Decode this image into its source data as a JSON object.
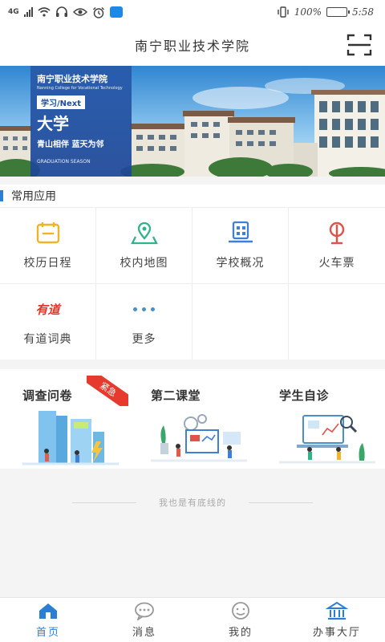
{
  "status_bar": {
    "network": "4G",
    "battery_text": "100%",
    "battery_level": 1.0,
    "time": "5:58",
    "icons": [
      "signal-icon",
      "wifi-icon",
      "headset-icon",
      "eye-icon",
      "alarm-icon",
      "app-notification-icon",
      "vibrate-icon",
      "battery-icon"
    ]
  },
  "header": {
    "title": "南宁职业技术学院",
    "scan_icon": "scan-icon"
  },
  "banner": {
    "school_name": "南宁职业技术学院",
    "school_name_en": "Nanning College for Vocational Technology",
    "tag": "学习/Next",
    "big_text": "大学",
    "slogan": "青山相伴  蓝天为邻",
    "graduation": "GRADUATION SEASON"
  },
  "common_apps": {
    "title": "常用应用",
    "items": [
      {
        "label": "校历日程",
        "icon": "calendar-icon",
        "color": "#f0b429"
      },
      {
        "label": "校内地图",
        "icon": "map-pin-icon",
        "color": "#2fb38a"
      },
      {
        "label": "学校概况",
        "icon": "building-icon",
        "color": "#3f7fd4"
      },
      {
        "label": "火车票",
        "icon": "train-icon",
        "color": "#e2514a"
      },
      {
        "label": "有道词典",
        "icon": "youdao-icon",
        "logo_text": "有道",
        "color": "#e0362c"
      },
      {
        "label": "更多",
        "icon": "more-icon",
        "color": "#4a90c8"
      }
    ]
  },
  "features": [
    {
      "title": "调查问卷",
      "badge": "紧急",
      "art": "survey-illustration"
    },
    {
      "title": "第二课堂",
      "art": "classroom-illustration"
    },
    {
      "title": "学生自诊",
      "art": "self-diagnosis-illustration"
    }
  ],
  "bottom_note": "我也是有底线的",
  "tabbar": {
    "items": [
      {
        "label": "首页",
        "icon": "home-icon",
        "active": true
      },
      {
        "label": "消息",
        "icon": "message-icon",
        "active": false
      },
      {
        "label": "我的",
        "icon": "profile-icon",
        "active": false
      },
      {
        "label": "办事大厅",
        "icon": "hall-icon",
        "active": false
      }
    ]
  },
  "colors": {
    "accent": "#2a7fd4",
    "urgent": "#e63a2e"
  }
}
